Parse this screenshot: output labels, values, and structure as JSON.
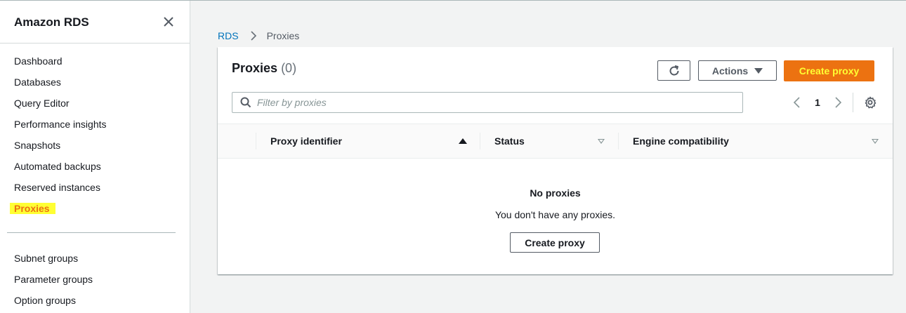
{
  "sidebar": {
    "title": "Amazon RDS",
    "items": [
      {
        "label": "Dashboard"
      },
      {
        "label": "Databases"
      },
      {
        "label": "Query Editor"
      },
      {
        "label": "Performance insights"
      },
      {
        "label": "Snapshots"
      },
      {
        "label": "Automated backups"
      },
      {
        "label": "Reserved instances"
      },
      {
        "label": "Proxies",
        "active": true
      }
    ],
    "items2": [
      {
        "label": "Subnet groups"
      },
      {
        "label": "Parameter groups"
      },
      {
        "label": "Option groups"
      }
    ]
  },
  "breadcrumb": {
    "root": "RDS",
    "current": "Proxies"
  },
  "panel": {
    "title": "Proxies",
    "count": "(0)",
    "actions_label": "Actions",
    "create_label": "Create proxy",
    "search_placeholder": "Filter by proxies",
    "page": "1",
    "columns": [
      {
        "label": "Proxy identifier",
        "sort": "ascending"
      },
      {
        "label": "Status",
        "sort": "none"
      },
      {
        "label": "Engine compatibility",
        "sort": "none"
      }
    ],
    "empty_title": "No proxies",
    "empty_desc": "You don't have any proxies.",
    "empty_button": "Create proxy"
  },
  "colors": {
    "primary": "#ec7211",
    "primary_text": "#ffff33",
    "link": "#0073bb",
    "highlight": "#ffff33"
  }
}
